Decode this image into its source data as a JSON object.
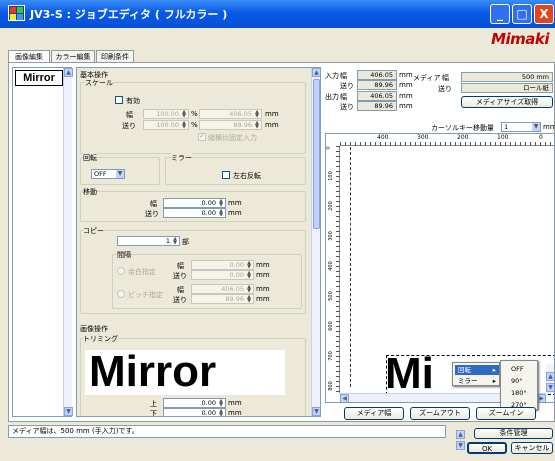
{
  "window": {
    "title": "JV3-S : ジョブエディタ ( フルカラー )",
    "brand": "Mimaki",
    "min_label": "_",
    "max_label": "□",
    "close_label": "X"
  },
  "tabs": [
    "画像編集",
    "カラー編集",
    "印刷条件"
  ],
  "thumbnail": {
    "label": "Mirror"
  },
  "basic": {
    "group_title": "基本操作",
    "scale": {
      "title": "スケール",
      "enable_label": "有効",
      "width_label": "幅",
      "feed_label": "送り",
      "width_percent": "100.00",
      "feed_percent": "100.00",
      "percent_unit": "%",
      "width_mm": "406.05",
      "feed_mm": "89.96",
      "mm_unit": "mm",
      "ratio_label": "縦横比固定入力"
    },
    "rotate": {
      "title": "回転",
      "value": "OFF"
    },
    "mirror": {
      "title": "ミラー",
      "option_label": "左右反転"
    },
    "move": {
      "title": "移動",
      "width_label": "幅",
      "feed_label": "送り",
      "width": "0.00",
      "feed": "0.00",
      "unit": "mm"
    },
    "copy": {
      "title": "コピー",
      "count": "1",
      "count_unit": "部",
      "gap_title": "間隔",
      "margin_label": "余白指定",
      "pitch_label": "ピッチ指定",
      "width_label": "幅",
      "feed_label": "送り",
      "margin_width": "0.00",
      "margin_feed": "0.00",
      "pitch_width": "406.05",
      "pitch_feed": "89.96",
      "unit": "mm"
    }
  },
  "image_ops": {
    "group_title": "画像操作",
    "trimming_title": "トリミング",
    "preview_text": "Mirror",
    "top_label": "上",
    "bottom_label": "下",
    "top": "0.00",
    "bottom": "0.00",
    "unit": "mm"
  },
  "info": {
    "input_label": "入力",
    "output_label": "出力",
    "width_label": "幅",
    "feed_label": "送り",
    "input_width": "406.05",
    "input_feed": "89.96",
    "output_width": "406.05",
    "output_feed": "89.96",
    "unit": "mm",
    "media_label": "メディア",
    "media_width_label": "幅",
    "media_feed_label": "送り",
    "media_width": "500 mm",
    "media_feed": "ロール紙",
    "get_media_button": "メディアサイズ取得"
  },
  "cursor": {
    "label": "カーソルキー移動量",
    "value": "1",
    "unit": "mm"
  },
  "ruler": {
    "top_ticks": [
      "400",
      "300",
      "200",
      "100",
      "0"
    ],
    "side_ticks": [
      "0",
      "100",
      "200",
      "300",
      "400",
      "500",
      "600",
      "700",
      "800"
    ]
  },
  "canvas": {
    "preview_text": "Mi"
  },
  "context_menu": {
    "items": [
      "回転",
      "ミラー"
    ],
    "submenu": [
      "OFF",
      "90°",
      "180°",
      "270°"
    ]
  },
  "preview_buttons": {
    "media_width": "メディア幅",
    "zoom_out": "ズームアウト",
    "zoom_in": "ズームイン"
  },
  "status": {
    "message": "メディア幅は、500 mm (手入力)です。"
  },
  "bottom": {
    "condition_button": "条件管理",
    "ok_button": "OK",
    "cancel_button": "キャンセル"
  }
}
